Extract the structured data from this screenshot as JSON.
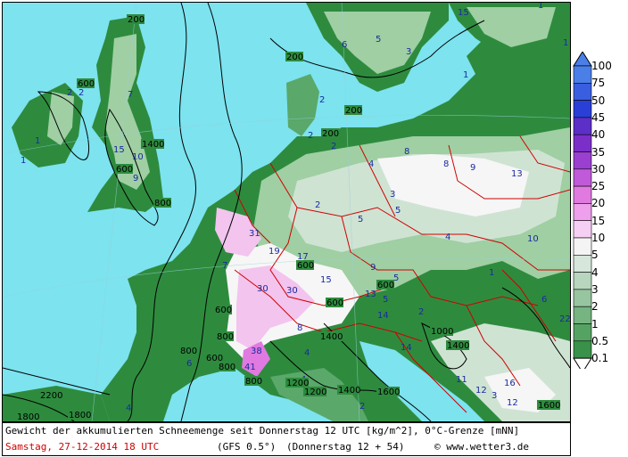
{
  "map": {
    "sea_color": "#7ce3ef",
    "land_colors": {
      "dark_green": "#2e8b3e",
      "mid_green": "#5aa86a",
      "light_green": "#9fcfa3",
      "pale": "#cfe3d3",
      "white": "#f6f6f6",
      "pink": "#f2c4ee",
      "magenta": "#e07ae0"
    },
    "border_color": "#d00000",
    "contour_color": "#000000",
    "snow_labels": [
      "15",
      "6",
      "5",
      "3",
      "1",
      "1",
      "1",
      "2",
      "2",
      "1",
      "1",
      "7",
      "15",
      "10",
      "9",
      "2",
      "2",
      "2",
      "4",
      "8",
      "8",
      "9",
      "13",
      "2",
      "5",
      "3",
      "5",
      "4",
      "31",
      "19",
      "17",
      "7",
      "30",
      "30",
      "15",
      "9",
      "5",
      "10",
      "13",
      "5",
      "1",
      "6",
      "22",
      "8",
      "14",
      "2",
      "12",
      "41",
      "38",
      "4",
      "14",
      "6",
      "4",
      "11",
      "16",
      "3",
      "12",
      "2",
      "4"
    ],
    "freezing_labels": [
      "200",
      "200",
      "200",
      "600",
      "200",
      "800",
      "600",
      "1400",
      "600",
      "600",
      "600",
      "600",
      "800",
      "1200",
      "800",
      "800",
      "600",
      "800",
      "1000",
      "1400",
      "1200",
      "1600",
      "1400",
      "1400",
      "1800",
      "1600",
      "2200",
      "1800"
    ]
  },
  "legend": {
    "values": [
      "100",
      "75",
      "50",
      "45",
      "40",
      "35",
      "30",
      "25",
      "20",
      "15",
      "10",
      "5",
      "4",
      "3",
      "2",
      "1",
      "0.5",
      "0.1"
    ],
    "colors": [
      "#4a7fe8",
      "#3a5ee0",
      "#2a3fd8",
      "#5b2fc8",
      "#7b2fc8",
      "#9a3fd0",
      "#c05ad8",
      "#e07ae0",
      "#eea0ec",
      "#f6d0f4",
      "#f4f4f4",
      "#d6e6da",
      "#b7d6bd",
      "#97c59f",
      "#76b481",
      "#55a363",
      "#3a9149"
    ]
  },
  "caption": {
    "line1": "Gewicht der akkumulierten Schneemenge seit Donnerstag 12 UTC [kg/m^2], 0°C-Grenze [mNN]",
    "date": "Samstag, 27-12-2014  18 UTC",
    "model": "(GFS 0.5°)",
    "run": "(Donnerstag 12 + 54)",
    "copyright": "© www.wetter3.de"
  }
}
